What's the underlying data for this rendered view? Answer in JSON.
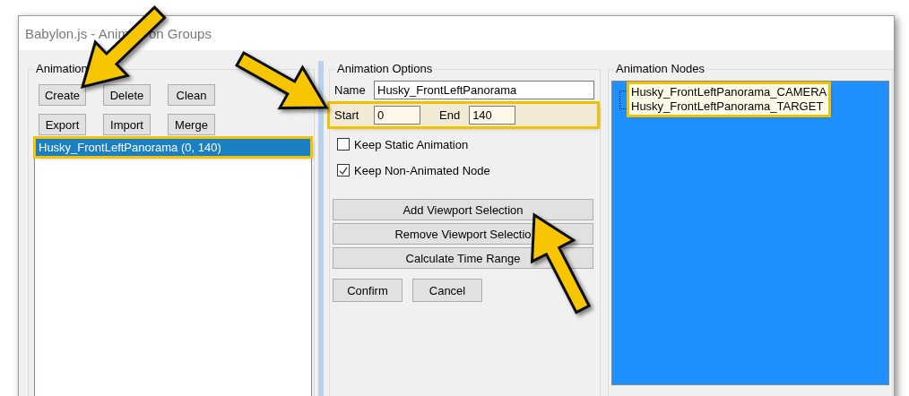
{
  "window": {
    "title": [
      "Babylon.js - Anim",
      "on Groups"
    ]
  },
  "groups_panel": {
    "label": "Animation",
    "buttons": [
      "Create",
      "Delete",
      "Clean",
      "Export",
      "Import",
      "Merge"
    ],
    "items": [
      {
        "label": "Husky_FrontLeftPanorama (0, 140)",
        "selected": true,
        "highlighted": true
      }
    ]
  },
  "options_panel": {
    "label": "Animation Options",
    "name_label": "Name",
    "name_value": "Husky_FrontLeftPanorama",
    "start_label": "Start",
    "start_value": "0",
    "end_label": "End",
    "end_value": "140",
    "range_highlighted": true,
    "checkboxes": [
      {
        "label": "Keep Static Animation",
        "checked": false
      },
      {
        "label": "Keep Non-Animated Node",
        "checked": true
      }
    ],
    "actions": [
      "Add Viewport Selection",
      "Remove Viewport Selectio",
      "Calculate Time Range"
    ],
    "buttons": [
      "Confirm",
      "Cancel"
    ]
  },
  "nodes_panel": {
    "label": "Animation Nodes",
    "highlighted": true,
    "nodes": [
      "Husky_FrontLeftPanorama_CAMERA",
      "Husky_FrontLeftPanorama_TARGET"
    ]
  }
}
